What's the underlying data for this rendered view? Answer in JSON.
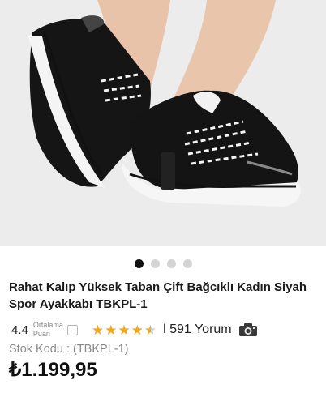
{
  "gallery": {
    "image_alt": "Black chunky sneaker on foot",
    "slide_count": 4,
    "active_slide": 1
  },
  "product": {
    "title": "Rahat Kalıp Yüksek Taban Çift Bağcıklı Kadın Siyah Spor Ayakkabı TBKPL-1",
    "stock_code": "Stok Kodu : (TBKPL-1)",
    "price": "₺1.199,95"
  },
  "rating": {
    "value": "4.4",
    "caption": "Ortalama Puan",
    "stars": 4.4,
    "reviews_text": "l 591 Yorum"
  },
  "icons": {
    "star": "star-icon",
    "camera": "camera-icon",
    "checkbox": "checkbox-icon"
  },
  "colors": {
    "star": "#f3a81a",
    "dot_active": "#111111",
    "dot_inactive": "#d4d4d4"
  }
}
